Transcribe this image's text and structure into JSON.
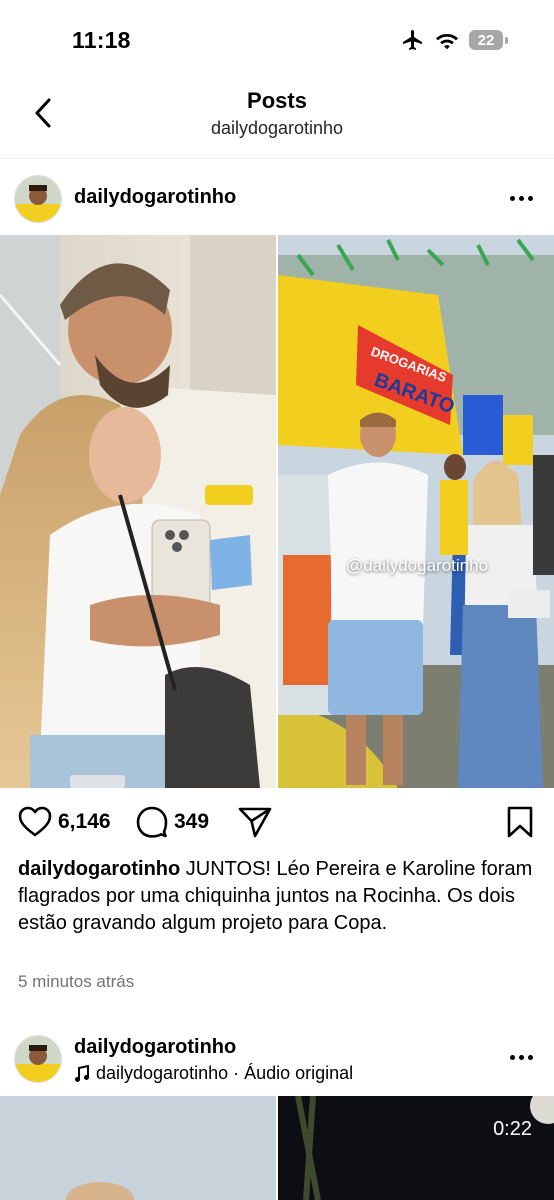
{
  "status_bar": {
    "time": "11:18",
    "battery": "22",
    "icons": [
      "airplane-icon",
      "wifi-icon",
      "battery-icon"
    ]
  },
  "header": {
    "title": "Posts",
    "subtitle": "dailydogarotinho"
  },
  "post1": {
    "username": "dailydogarotinho",
    "watermark": "@dailydogarotinho",
    "sign_text_1": "DROGARIAS",
    "sign_text_2": "BARATO",
    "likes": "6,146",
    "comments": "349",
    "caption_user": "dailydogarotinho",
    "caption_text": "JUNTOS! Léo Pereira e Karoline foram flagrados por uma chiquinha juntos na Rocinha. Os dois estão gravando algum projeto para Copa.",
    "time_ago": "5 minutos atrás"
  },
  "post2": {
    "username": "dailydogarotinho",
    "audio_text": "dailydogarotinho · Áudio original",
    "video_time": "0:22"
  },
  "colors": {
    "accent_yellow": "#f2cf1f",
    "sky": "#c9d6e0",
    "muted": "#737373"
  }
}
